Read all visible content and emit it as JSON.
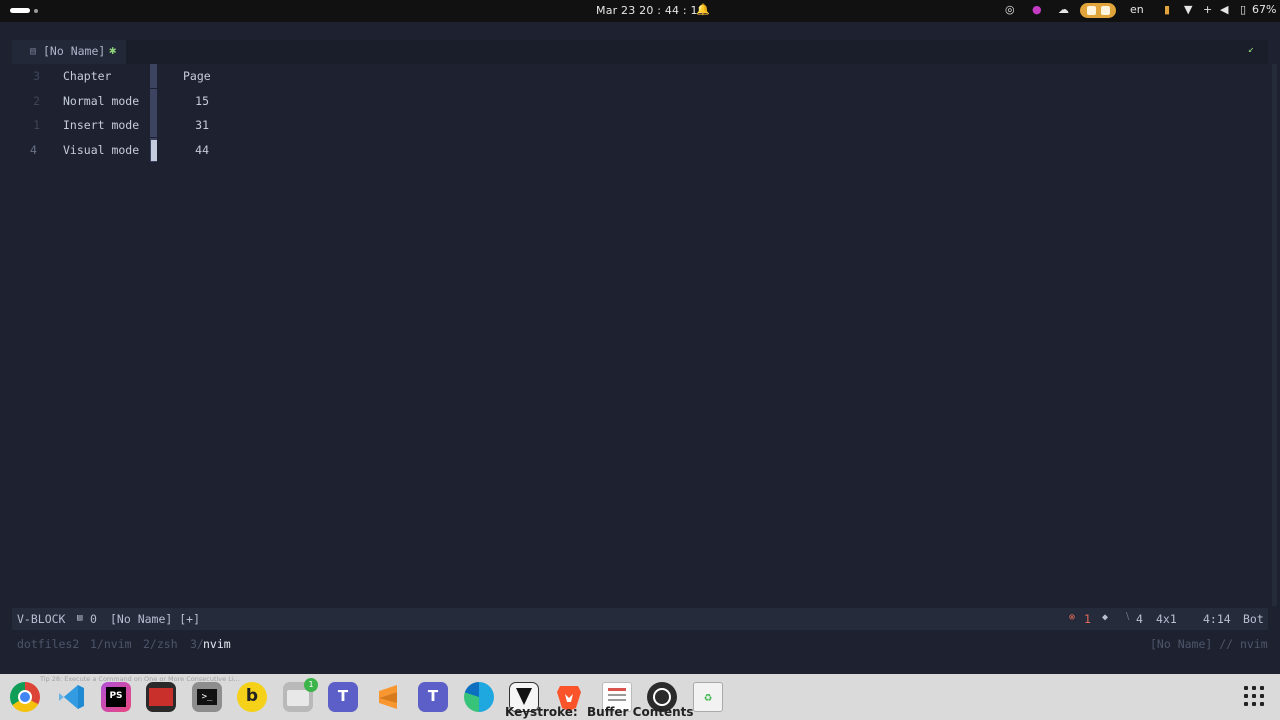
{
  "topbar": {
    "clock": "Mar 23  20 : 44 : 18",
    "language": "en",
    "battery": "67%"
  },
  "tab": {
    "name": "[No Name]",
    "modified_marker": "✱"
  },
  "buffer": {
    "lines": [
      {
        "num": "3",
        "col1": "Chapter",
        "col2": "Page",
        "current": false
      },
      {
        "num": "2",
        "col1": "Normal mode",
        "col2": "15",
        "current": false
      },
      {
        "num": "1",
        "col1": "Insert mode",
        "col2": "31",
        "current": false
      },
      {
        "num": "4",
        "col1": "Visual mode",
        "col2": "44",
        "current": true
      }
    ]
  },
  "statusline": {
    "mode": "V-BLOCK",
    "buffer_count": "0",
    "filename": "[No Name] [+]",
    "errors": "1",
    "selection_lines": "4",
    "selection_size": "4x1",
    "position": "4:14",
    "scroll": "Bot"
  },
  "tmux": {
    "session": "dotfiles2",
    "win1": "1/nvim",
    "win2": "2/zsh",
    "win3_prefix": "3/",
    "win3_name": "nvim",
    "right": "[No Name] // nvim"
  },
  "dock": {
    "tooltip": "Tip 28: Execute a Command on One or More Consecutive Li...",
    "badge": "1",
    "keystroke_label": "Keystroke:",
    "keystroke_value": "Buffer Contents",
    "apps": [
      "chrome-icon",
      "vscode-icon",
      "phpstorm-icon",
      "terminal-red-icon",
      "terminal-icon",
      "bitwarden-b-icon",
      "files-icon",
      "teams-icon",
      "sublime-icon",
      "teams-2-icon",
      "edge-icon",
      "inkscape-icon",
      "brave-icon",
      "document-viewer-icon",
      "obs-icon",
      "trash-icon"
    ],
    "colors": {
      "accent": "#e0a43a",
      "modified": "#8fd27a"
    }
  }
}
